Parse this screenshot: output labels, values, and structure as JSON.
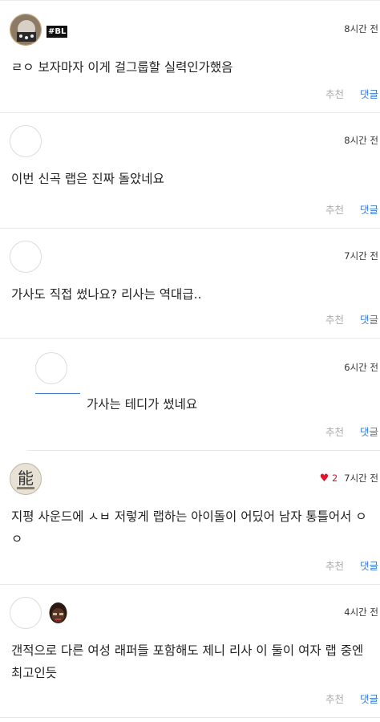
{
  "comments": [
    {
      "badge": "#BL",
      "time": "8시간 전",
      "text": "ㄹㅇ 보자마자 이게 걸그룹할 실력인가했음",
      "recommend": "추천",
      "reply": "댓글"
    },
    {
      "time": "8시간 전",
      "text": "이번 신곡 랩은 진짜 돌았네요",
      "recommend": "추천",
      "reply": "댓글"
    },
    {
      "time": "7시간 전",
      "text": "가사도 직접 썼나요? 리사는 역대급..",
      "recommend": "추천",
      "reply": "댓글"
    },
    {
      "time": "6시간 전",
      "text": "가사는 테디가 썼네요",
      "recommend": "추천",
      "reply": "댓글"
    },
    {
      "heart": "♥",
      "likes": "2",
      "time": "7시간 전",
      "avatar_char": "能",
      "text": "지평 사운드에 ㅅㅂ 저렇게 랩하는 아이돌이 어딨어 남자 통틀어서 ㅇㅇ",
      "recommend": "추천",
      "reply": "댓글"
    },
    {
      "time": "4시간 전",
      "text": "갠적으로 다른 여성 래퍼들 포함해도 제니 리사 이 둘이 여자 랩 중엔 최고인듯",
      "recommend": "추천",
      "reply": "댓글"
    }
  ]
}
